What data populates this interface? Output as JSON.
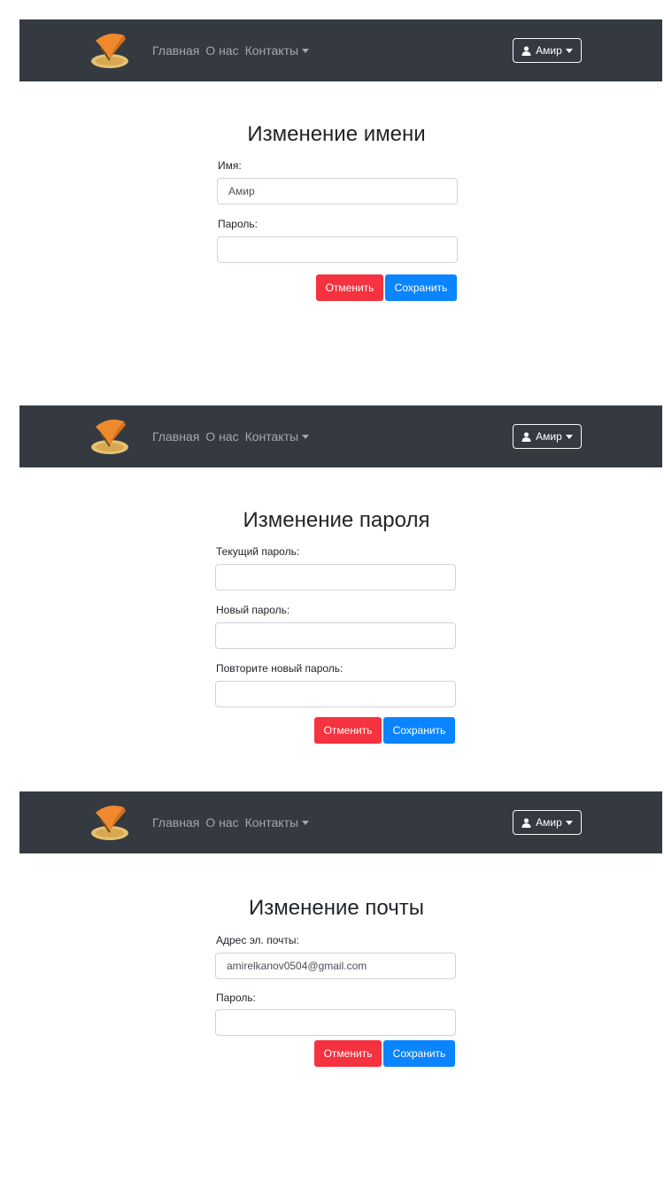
{
  "navbar": {
    "links": [
      {
        "label": "Главная"
      },
      {
        "label": "О нас"
      },
      {
        "label": "Контакты"
      }
    ],
    "user_label": "Амир",
    "colors": {
      "background": "#343a40",
      "link": "rgba(255,255,255,0.55)"
    }
  },
  "forms": [
    {
      "title": "Изменение имени",
      "fields": [
        {
          "label": "Имя:",
          "value": "Амир"
        },
        {
          "label": "Пароль:",
          "value": ""
        }
      ],
      "cancel_label": "Отменить",
      "save_label": "Сохранить"
    },
    {
      "title": "Изменение пароля",
      "fields": [
        {
          "label": "Текущий пароль:",
          "value": ""
        },
        {
          "label": "Новый пароль:",
          "value": ""
        },
        {
          "label": "Повторите новый пароль:",
          "value": ""
        }
      ],
      "cancel_label": "Отменить",
      "save_label": "Сохранить"
    },
    {
      "title": "Изменение почты",
      "fields": [
        {
          "label": "Адрес эл. почты:",
          "value": "amirelkanov0504@gmail.com"
        },
        {
          "label": "Пароль:",
          "value": ""
        }
      ],
      "cancel_label": "Отменить",
      "save_label": "Сохранить"
    }
  ],
  "colors": {
    "cancel": "#f5323f",
    "save": "#0a84ff"
  },
  "icons": {
    "logo": "orange-umbrella-logo",
    "user": "user-icon",
    "caret": "caret-down-icon"
  }
}
